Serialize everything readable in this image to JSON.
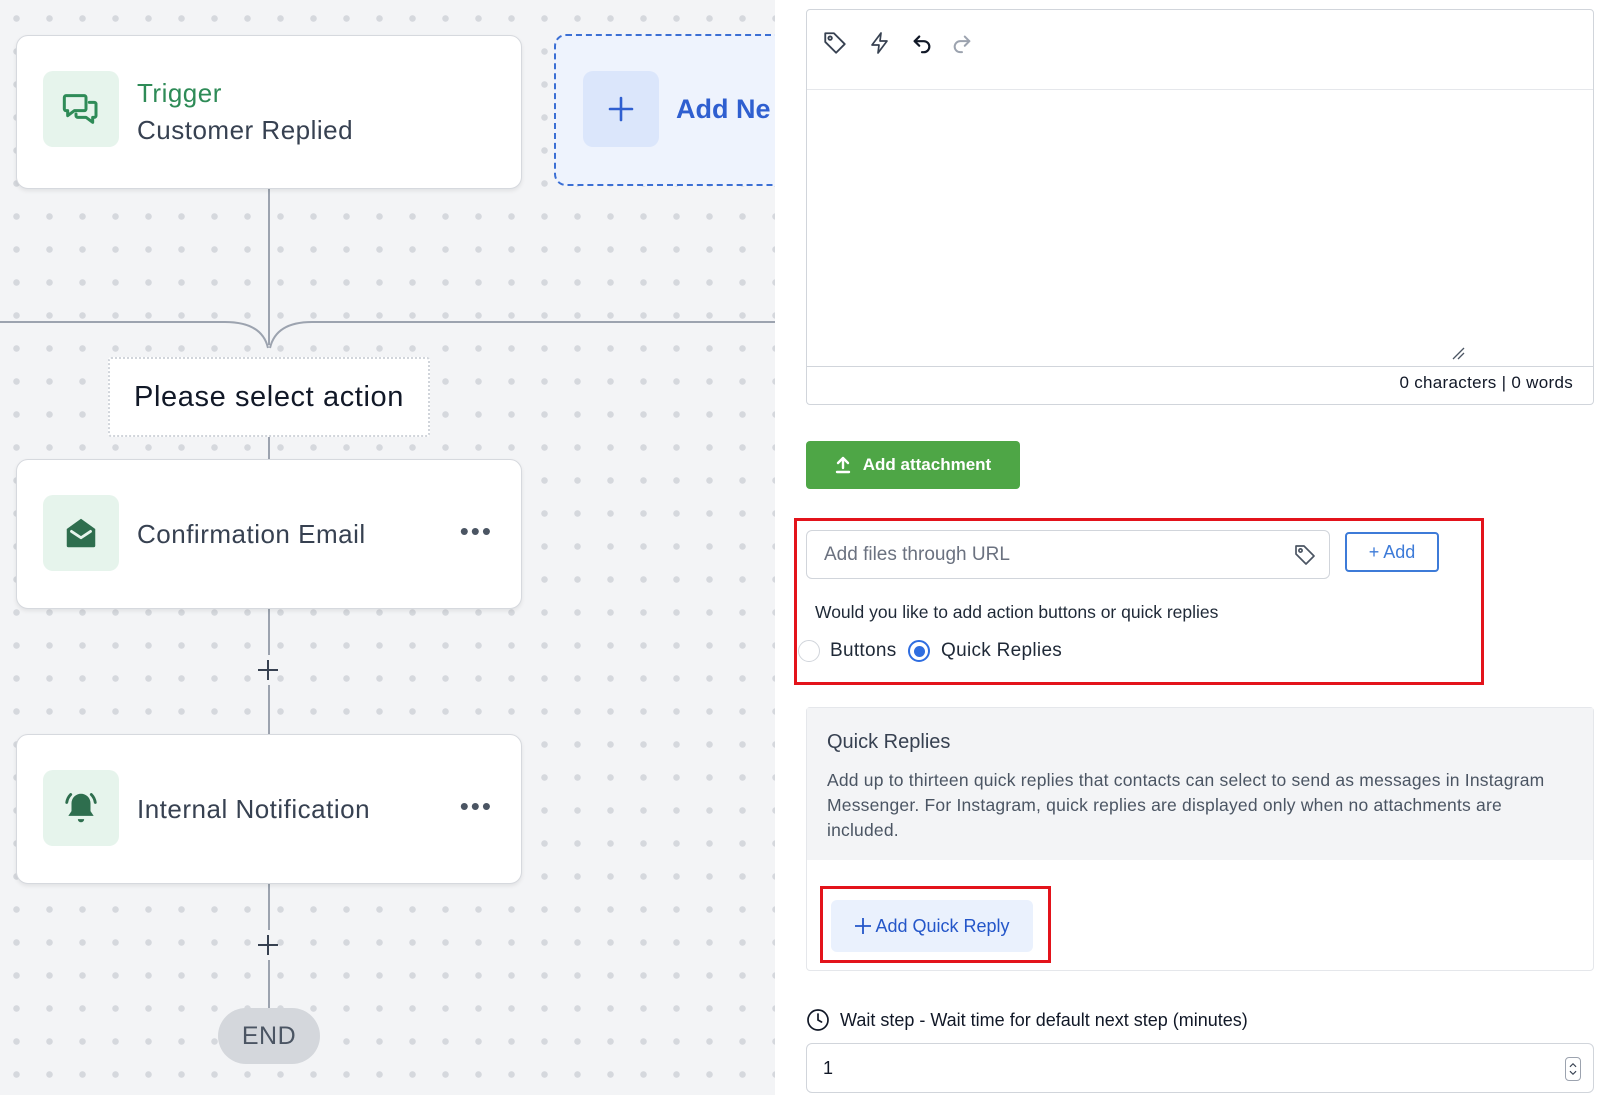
{
  "canvas": {
    "trigger": {
      "label": "Trigger",
      "name": "Customer Replied"
    },
    "add_new": {
      "label": "Add Ne"
    },
    "select_action": "Please select action",
    "steps": [
      {
        "title": "Confirmation Email",
        "icon": "envelope-open-icon",
        "menu": "•••"
      },
      {
        "title": "Internal Notification",
        "icon": "bell-ringing-icon",
        "menu": "•••"
      }
    ],
    "end": "END",
    "colors": {
      "trigger_green": "#2e8b57",
      "icon_bg": "#e6f4ec",
      "add_new_blue": "#2f5fd0"
    }
  },
  "panel": {
    "editor": {
      "toolbar_icons": [
        "tag-icon",
        "lightning-icon",
        "undo-icon",
        "redo-icon"
      ],
      "content": "",
      "char_count": "0 characters | 0 words"
    },
    "add_attachment": "Add attachment",
    "url_input": {
      "placeholder": "Add files through URL",
      "value": ""
    },
    "add_url_button": "+ Add",
    "reply_question": "Would you like to add action buttons or quick replies",
    "reply_options": [
      {
        "label": "Buttons",
        "selected": false
      },
      {
        "label": "Quick Replies",
        "selected": true
      }
    ],
    "quick_replies": {
      "title": "Quick Replies",
      "description": "Add up to thirteen quick replies that contacts can select to send as messages in Instagram Messenger. For Instagram, quick replies are displayed only when no attachments are included.",
      "add_button": "Add Quick Reply"
    },
    "wait_step": {
      "label": "Wait step - Wait time for default next step (minutes)",
      "value": "1"
    },
    "colors": {
      "attachment_green": "#4ea646",
      "highlight_red": "#e3131b",
      "primary_blue": "#2f6de0"
    }
  }
}
